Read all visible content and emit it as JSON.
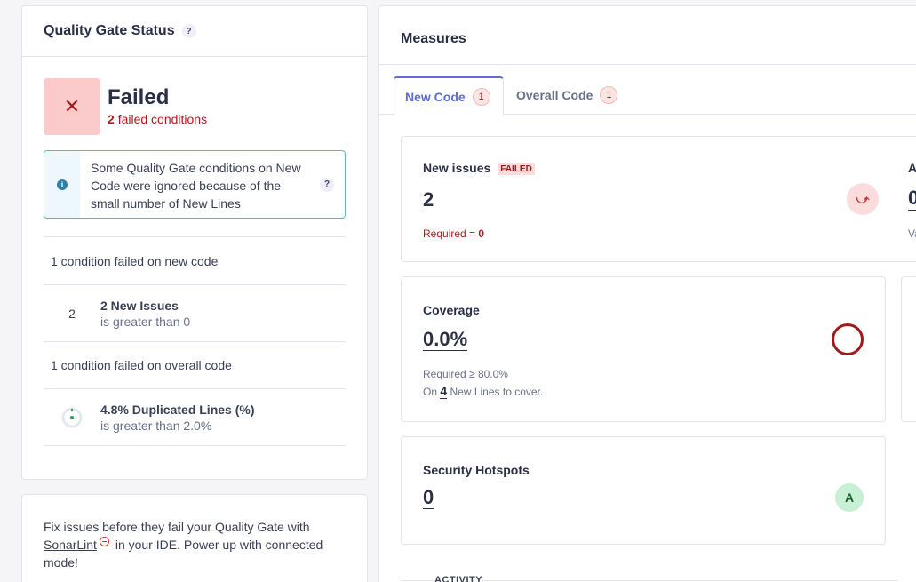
{
  "quality_gate": {
    "title": "Quality Gate Status",
    "help": "?",
    "status_label": "Failed",
    "failed_count": "2",
    "failed_text": "failed conditions",
    "info_message": "Some Quality Gate conditions on New Code were ignored because of the small number of New Lines",
    "info_help": "?",
    "new_code_heading": "1 condition failed on new code",
    "new_issues_condition": {
      "value": "2",
      "title": "2 New Issues",
      "subtitle": "is greater than 0"
    },
    "overall_heading": "1 condition failed on overall code",
    "duplication_condition": {
      "title": "4.8% Duplicated Lines (%)",
      "subtitle": "is greater than 2.0%"
    }
  },
  "tip": {
    "before": "Fix issues before they fail your Quality Gate with",
    "link": "SonarLint",
    "after": "in your IDE. Power up with connected mode!"
  },
  "measures": {
    "title": "Measures",
    "tabs": [
      {
        "label": "New Code",
        "count": "1"
      },
      {
        "label": "Overall Code",
        "count": "1"
      }
    ],
    "new_issues": {
      "label": "New issues",
      "badge": "FAILED",
      "value": "2",
      "required_prefix": "Required =",
      "required_value": "0"
    },
    "partial_card": {
      "label_initial": "A",
      "value_initial": "0",
      "sub_initial": "Va"
    },
    "coverage": {
      "label": "Coverage",
      "value": "0.0%",
      "required": "Required ≥ 80.0%",
      "on_prefix": "On",
      "lines": "4",
      "lines_suffix": "New Lines to cover."
    },
    "security_hotspots": {
      "label": "Security Hotspots",
      "value": "0",
      "rating": "A"
    },
    "activity_label": "ACTIVITY"
  },
  "colors": {
    "failed": "#b31b1b",
    "accent": "#5d6cd6",
    "info_border": "#5ab6d3",
    "rating_a": "#c8f0d4"
  }
}
